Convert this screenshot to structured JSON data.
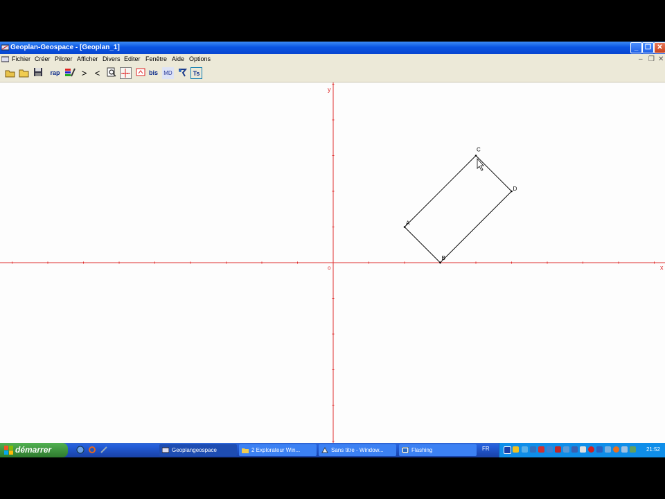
{
  "window": {
    "title": "Geoplan-Geospace - [Geoplan_1]"
  },
  "menu": {
    "items": [
      "Fichier",
      "Créer",
      "Piloter",
      "Afficher",
      "Divers",
      "Editer",
      "Fenêtre",
      "Aide",
      "Options"
    ]
  },
  "toolbar": {
    "rap_label": "rap",
    "bis_label": "bis",
    "md_label": "MD",
    "ts_label": "Ts"
  },
  "figure": {
    "axis_x_label": "x",
    "axis_y_label": "y",
    "origin_label": "o",
    "points": [
      {
        "name": "A",
        "x": 2,
        "y": 1
      },
      {
        "name": "B",
        "x": 3,
        "y": 0
      },
      {
        "name": "C",
        "x": 4,
        "y": 3
      },
      {
        "name": "D",
        "x": 5,
        "y": 2
      }
    ],
    "axis_color": "#e03030",
    "line_color": "#000000"
  },
  "taskbar": {
    "start_label": "démarrer",
    "tasks": [
      {
        "label": "Geoplangeospace",
        "active": true
      },
      {
        "label": "2 Explorateur Win...",
        "active": false
      },
      {
        "label": "Sans titre - Window...",
        "active": false
      },
      {
        "label": "Flashing",
        "active": false
      }
    ],
    "language": "FR",
    "clock": "21:52"
  }
}
